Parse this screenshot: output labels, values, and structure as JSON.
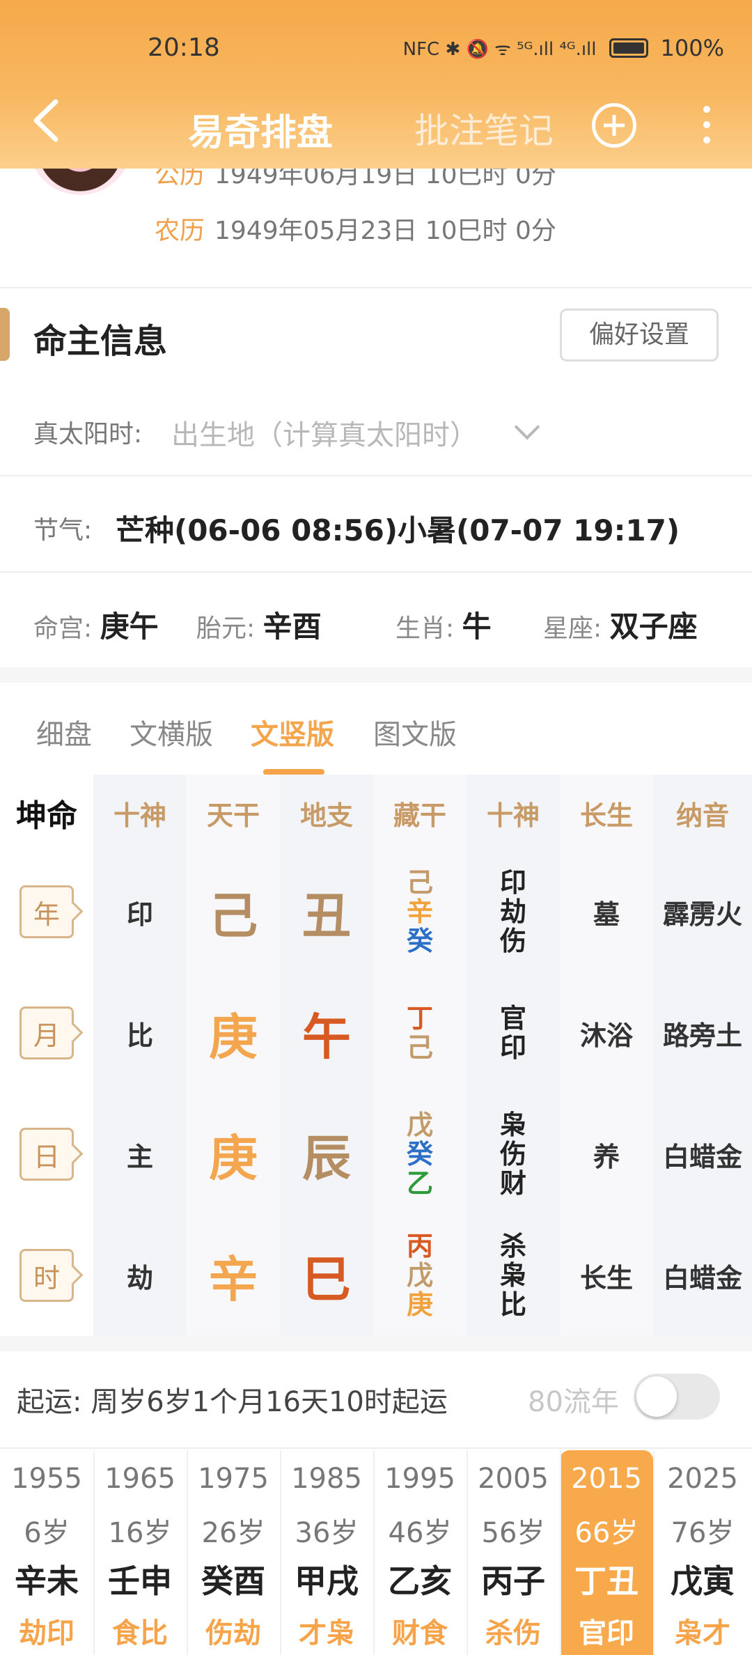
{
  "status": {
    "time": "20:18",
    "indicators": "NFC ✱ 🔕 ᯤ ⁵ᴳ.ıll ⁴ᴳ.ıll",
    "battery": "100%"
  },
  "header": {
    "title": "易奇排盘",
    "notes": "批注笔记"
  },
  "birth": {
    "solar_label": "公历",
    "solar_value": "1949年06月19日 10巳时 0分",
    "lunar_label": "农历",
    "lunar_value": "1949年05月23日 10巳时 0分"
  },
  "section": {
    "title": "命主信息",
    "pref_button": "偏好设置"
  },
  "solar_time": {
    "label": "真太阳时:",
    "value": "出生地（计算真太阳时）"
  },
  "jieqi": {
    "label": "节气:",
    "value": "芒种(06-06 08:56)小暑(07-07 19:17)"
  },
  "info": {
    "minggong_label": "命宫:",
    "minggong": "庚午",
    "taiyuan_label": "胎元:",
    "taiyuan": "辛酉",
    "shengxiao_label": "生肖:",
    "shengxiao": "牛",
    "xingzuo_label": "星座:",
    "xingzuo": "双子座"
  },
  "tabs": [
    "细盘",
    "文横版",
    "文竖版",
    "图文版"
  ],
  "active_tab": "文竖版",
  "grid": {
    "corner": "坤命",
    "headers": [
      "十神",
      "天干",
      "地支",
      "藏干",
      "十神",
      "长生",
      "纳音"
    ],
    "rows": [
      {
        "pillar": "年",
        "shishen": "印",
        "tiangan": "己",
        "dizhi": "丑",
        "canggan": [
          "己",
          "辛",
          "癸"
        ],
        "canggan_colors": [
          "#c39a6a",
          "#f2a23d",
          "#2b6fc7"
        ],
        "shishen2": [
          "印",
          "劫",
          "伤"
        ],
        "changsheng": "墓",
        "nayin": "霹雳火",
        "tg_color": "#b58d62",
        "dz_color": "#b58d62"
      },
      {
        "pillar": "月",
        "shishen": "比",
        "tiangan": "庚",
        "dizhi": "午",
        "canggan": [
          "丁",
          "己"
        ],
        "canggan_colors": [
          "#d65a22",
          "#c39a6a"
        ],
        "shishen2": [
          "官",
          "印"
        ],
        "changsheng": "沐浴",
        "nayin": "路旁土",
        "tg_color": "#f4a64e",
        "dz_color": "#d65a22"
      },
      {
        "pillar": "日",
        "shishen": "主",
        "tiangan": "庚",
        "dizhi": "辰",
        "canggan": [
          "戊",
          "癸",
          "乙"
        ],
        "canggan_colors": [
          "#c39a6a",
          "#2b6fc7",
          "#2e9a3a"
        ],
        "shishen2": [
          "枭",
          "伤",
          "财"
        ],
        "changsheng": "养",
        "nayin": "白蜡金",
        "tg_color": "#f4a64e",
        "dz_color": "#b58d62"
      },
      {
        "pillar": "时",
        "shishen": "劫",
        "tiangan": "辛",
        "dizhi": "巳",
        "canggan": [
          "丙",
          "戊",
          "庚"
        ],
        "canggan_colors": [
          "#d65a22",
          "#c39a6a",
          "#f2a23d"
        ],
        "shishen2": [
          "杀",
          "枭",
          "比"
        ],
        "changsheng": "长生",
        "nayin": "白蜡金",
        "tg_color": "#f4a64e",
        "dz_color": "#d65a22"
      }
    ]
  },
  "qiyun": {
    "text": "起运:  周岁6岁1个月16天10时起运",
    "liunian_label": "80流年"
  },
  "dayun": [
    {
      "year": "1955",
      "age": "6岁",
      "ganzhi": "辛未",
      "shishen": "劫印",
      "selected": false
    },
    {
      "year": "1965",
      "age": "16岁",
      "ganzhi": "壬申",
      "shishen": "食比",
      "selected": false
    },
    {
      "year": "1975",
      "age": "26岁",
      "ganzhi": "癸酉",
      "shishen": "伤劫",
      "selected": false
    },
    {
      "year": "1985",
      "age": "36岁",
      "ganzhi": "甲戌",
      "shishen": "才枭",
      "selected": false
    },
    {
      "year": "1995",
      "age": "46岁",
      "ganzhi": "乙亥",
      "shishen": "财食",
      "selected": false
    },
    {
      "year": "2005",
      "age": "56岁",
      "ganzhi": "丙子",
      "shishen": "杀伤",
      "selected": false
    },
    {
      "year": "2015",
      "age": "66岁",
      "ganzhi": "丁丑",
      "shishen": "官印",
      "selected": true
    },
    {
      "year": "2025",
      "age": "76岁",
      "ganzhi": "戊寅",
      "shishen": "枭才",
      "selected": false
    }
  ]
}
